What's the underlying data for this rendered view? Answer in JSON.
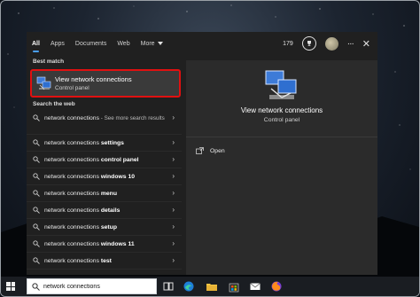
{
  "tabs": [
    {
      "label": "All",
      "active": true
    },
    {
      "label": "Apps",
      "active": false
    },
    {
      "label": "Documents",
      "active": false
    },
    {
      "label": "Web",
      "active": false
    },
    {
      "label": "More",
      "active": false
    }
  ],
  "header": {
    "points": "179"
  },
  "best_match": {
    "section_label": "Best match",
    "title": "View network connections",
    "subtitle": "Control panel"
  },
  "web": {
    "section_label": "Search the web",
    "items": [
      {
        "prefix": "network connections",
        "bold": "",
        "hint": " - See more search results"
      },
      {
        "prefix": "network connections ",
        "bold": "settings",
        "hint": ""
      },
      {
        "prefix": "network connections ",
        "bold": "control panel",
        "hint": ""
      },
      {
        "prefix": "network connections ",
        "bold": "windows 10",
        "hint": ""
      },
      {
        "prefix": "network connections ",
        "bold": "menu",
        "hint": ""
      },
      {
        "prefix": "network connections ",
        "bold": "details",
        "hint": ""
      },
      {
        "prefix": "network connections ",
        "bold": "setup",
        "hint": ""
      },
      {
        "prefix": "network connections ",
        "bold": "windows 11",
        "hint": ""
      },
      {
        "prefix": "network connections ",
        "bold": "test",
        "hint": ""
      }
    ]
  },
  "preview": {
    "title": "View network connections",
    "subtitle": "Control panel",
    "open_label": "Open"
  },
  "taskbar": {
    "search_value": "network connections"
  },
  "colors": {
    "highlight_border": "#e01010",
    "accent": "#4aa0ff"
  }
}
